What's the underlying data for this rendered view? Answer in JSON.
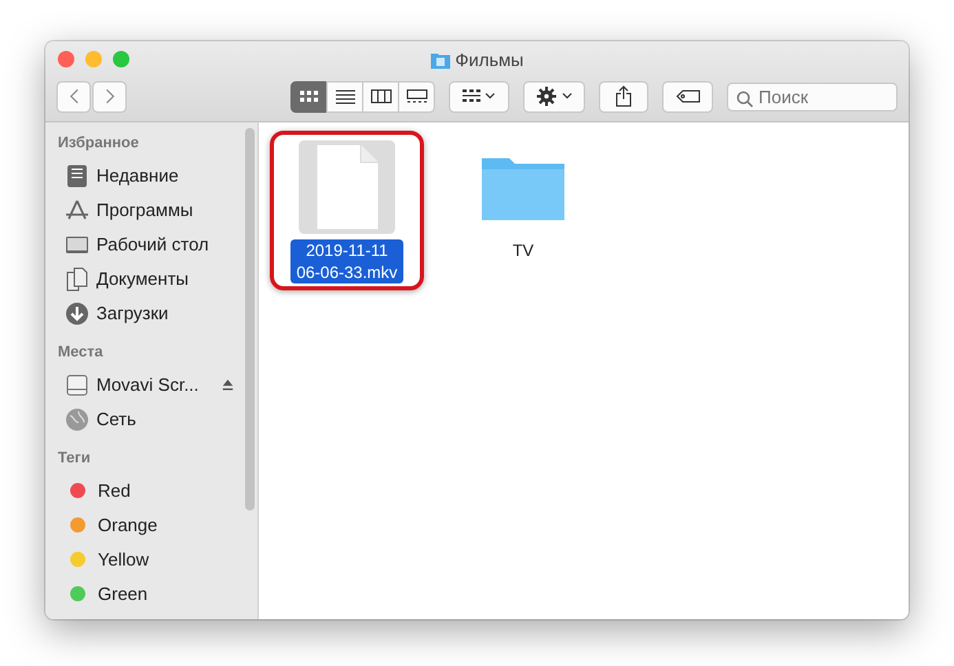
{
  "window": {
    "title": "Фильмы"
  },
  "toolbar": {
    "view_modes": [
      {
        "kind": "icons",
        "selected": true
      },
      {
        "kind": "list",
        "selected": false
      },
      {
        "kind": "columns",
        "selected": false
      },
      {
        "kind": "gallery",
        "selected": false
      }
    ],
    "search": {
      "placeholder": "Поиск"
    }
  },
  "sidebar": {
    "sections": [
      {
        "title": "Избранное",
        "items": [
          {
            "label": "Недавние",
            "kind": "recents"
          },
          {
            "label": "Программы",
            "kind": "apps"
          },
          {
            "label": "Рабочий стол",
            "kind": "desktop"
          },
          {
            "label": "Документы",
            "kind": "documents"
          },
          {
            "label": "Загрузки",
            "kind": "downloads"
          }
        ]
      },
      {
        "title": "Места",
        "items": [
          {
            "label": "Movavi Scr...",
            "kind": "drive",
            "eject": true
          },
          {
            "label": "Сеть",
            "kind": "network"
          }
        ]
      },
      {
        "title": "Теги",
        "items": [
          {
            "label": "Red",
            "kind": "tag",
            "color": "#f04a50"
          },
          {
            "label": "Orange",
            "kind": "tag",
            "color": "#f49a33"
          },
          {
            "label": "Yellow",
            "kind": "tag",
            "color": "#f5cc30"
          },
          {
            "label": "Green",
            "kind": "tag",
            "color": "#4ecb5a"
          }
        ]
      }
    ]
  },
  "files": [
    {
      "name": "2019-11-11 06-06-33.mkv",
      "kind": "file",
      "selected": true,
      "annotated": true
    },
    {
      "name": "TV",
      "kind": "folder",
      "selected": false,
      "annotated": false
    }
  ]
}
